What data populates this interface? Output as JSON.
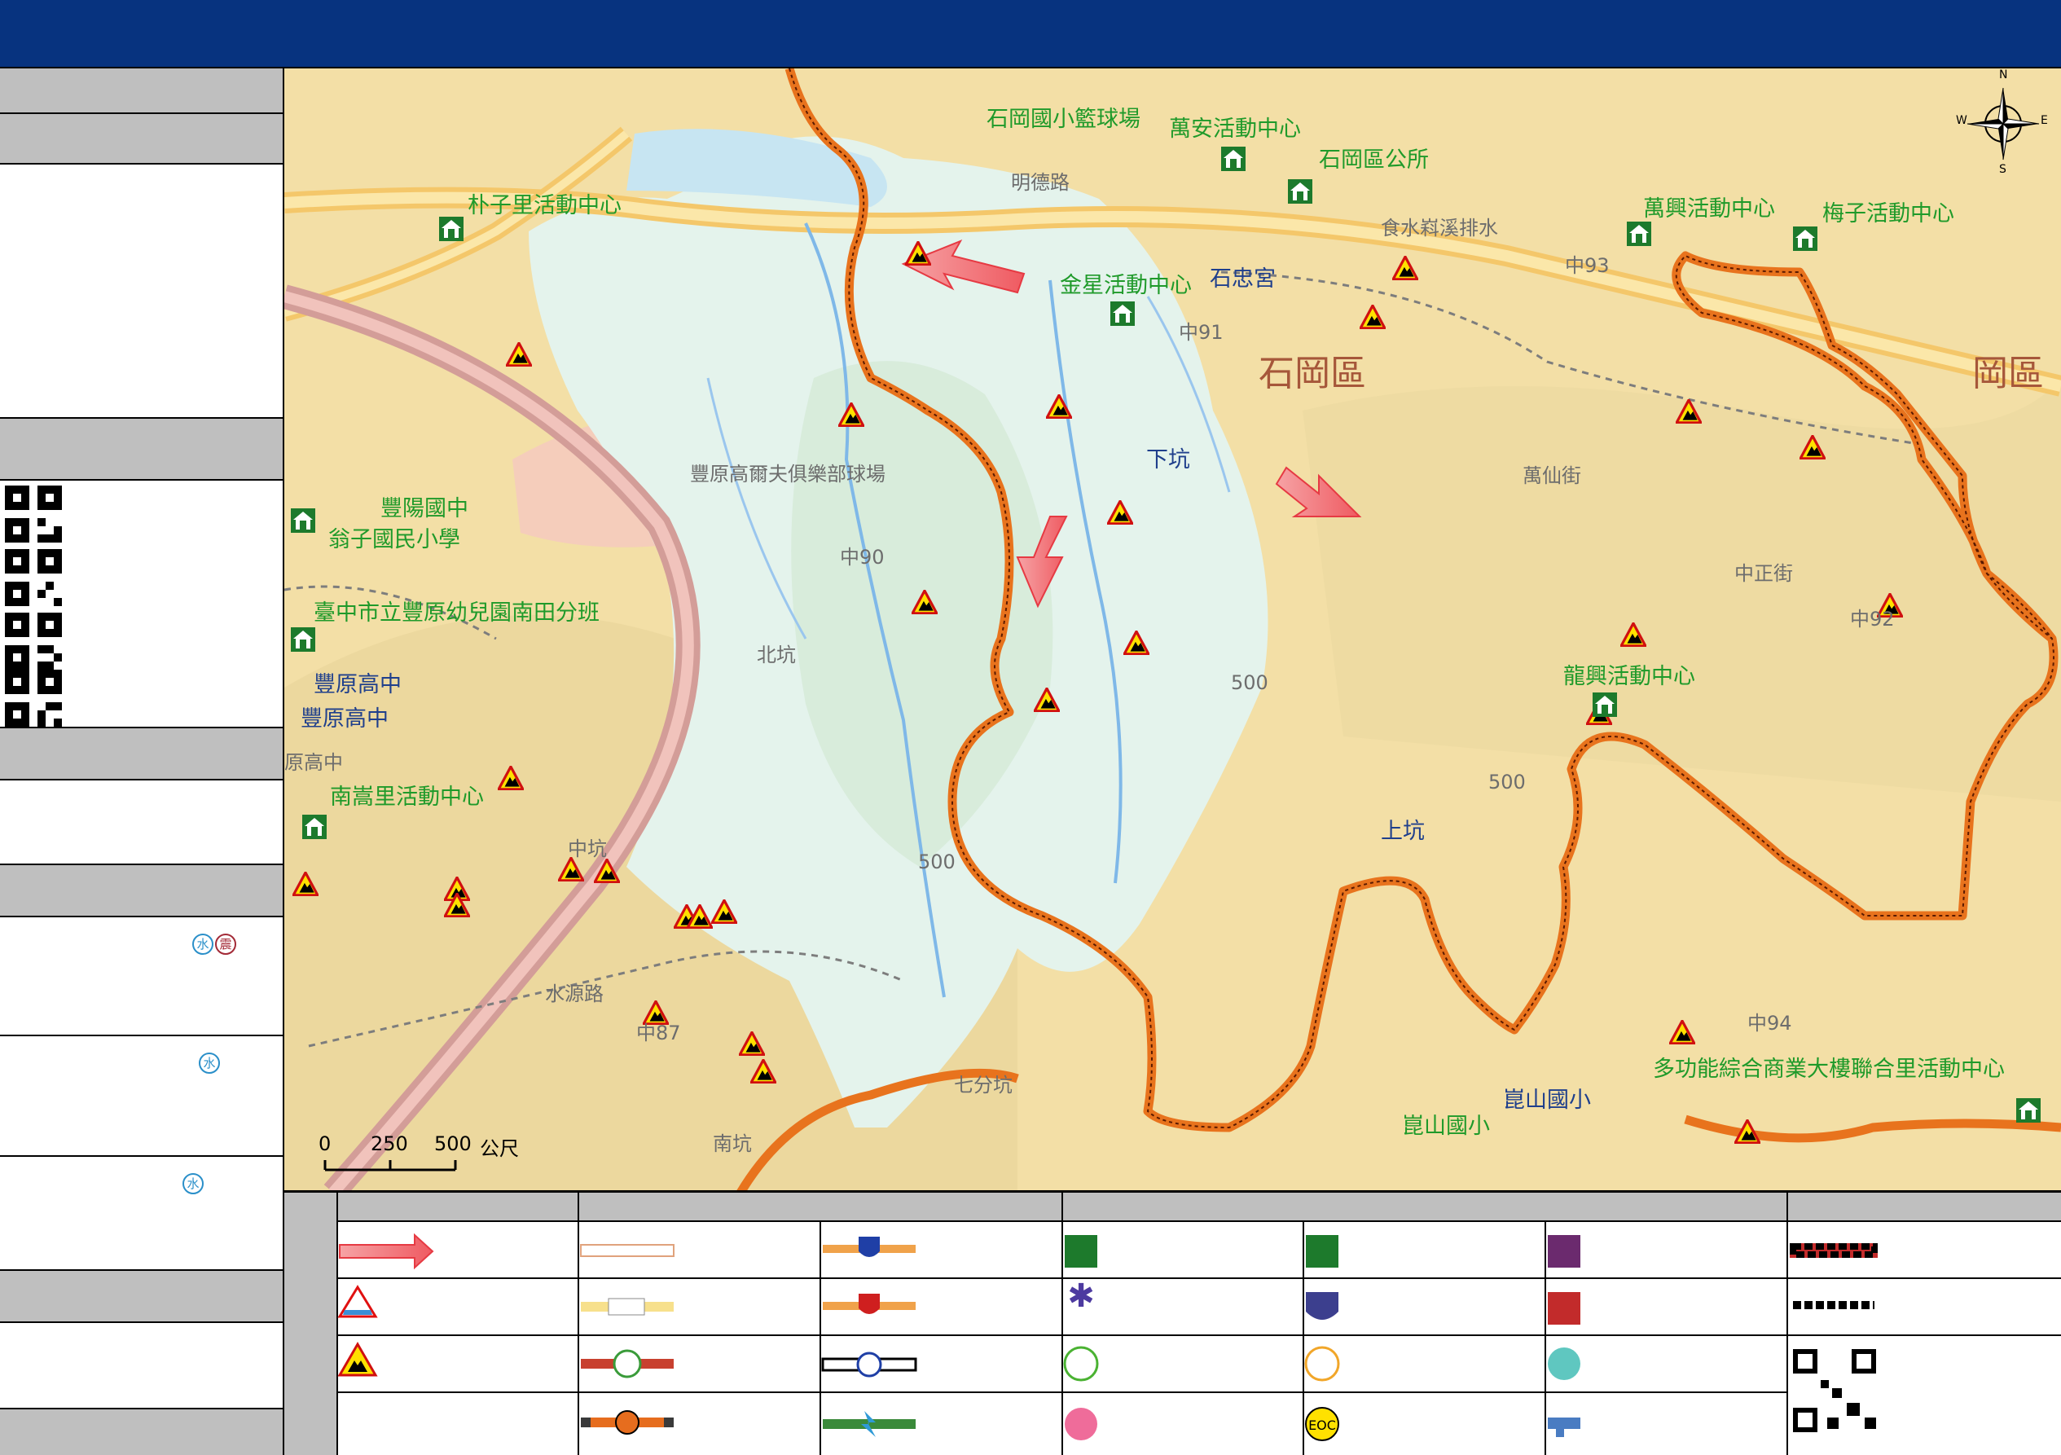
{
  "header": {
    "title": ""
  },
  "map": {
    "places": [
      {
        "id": "shigang-school",
        "text": "石岡國小籃球場",
        "cls": "g"
      },
      {
        "id": "wanan",
        "text": "萬安活動中心",
        "cls": "g"
      },
      {
        "id": "district-office",
        "text": "石岡區公所",
        "cls": "g"
      },
      {
        "id": "puzi",
        "text": "朴子里活動中心",
        "cls": "g"
      },
      {
        "id": "wanxing",
        "text": "萬興活動中心",
        "cls": "g"
      },
      {
        "id": "meizi",
        "text": "梅子活動中心",
        "cls": "g"
      },
      {
        "id": "jinxing",
        "text": "金星活動中心",
        "cls": "g"
      },
      {
        "id": "shizhong",
        "text": "石忠宮",
        "cls": "b"
      },
      {
        "id": "shigang-dist",
        "text": "石岡區",
        "cls": "d"
      },
      {
        "id": "gang-dist",
        "text": "岡區",
        "cls": "d"
      },
      {
        "id": "fengyang",
        "text": "豐陽國中",
        "cls": "g"
      },
      {
        "id": "wengzi",
        "text": "翁子國民小學",
        "cls": "g"
      },
      {
        "id": "golf",
        "text": "豐原高爾夫俱樂部球場",
        "cls": "s"
      },
      {
        "id": "kindergarten",
        "text": "臺中市立豐原幼兒園南田分班",
        "cls": "g"
      },
      {
        "id": "fengyuan-hs-1",
        "text": "豐原高中",
        "cls": "b"
      },
      {
        "id": "fengyuan-hs-2",
        "text": "豐原高中",
        "cls": "b"
      },
      {
        "id": "gaozhong",
        "text": "原高中",
        "cls": "s"
      },
      {
        "id": "nansong",
        "text": "南嵩里活動中心",
        "cls": "g"
      },
      {
        "id": "longxing",
        "text": "龍興活動中心",
        "cls": "g"
      },
      {
        "id": "kunshan-1",
        "text": "崑山國小",
        "cls": "b"
      },
      {
        "id": "kunshan-2",
        "text": "崑山國小",
        "cls": "g"
      },
      {
        "id": "multi",
        "text": "多功能綜合商業大樓聯合里活動中心",
        "cls": "g"
      },
      {
        "id": "mingde",
        "text": "明德路",
        "cls": "s"
      },
      {
        "id": "shuiyuan",
        "text": "水源路",
        "cls": "s"
      },
      {
        "id": "qifen",
        "text": "七分坑",
        "cls": "s"
      },
      {
        "id": "beikeng",
        "text": "北坑",
        "cls": "s"
      },
      {
        "id": "zhongkeng",
        "text": "中坑",
        "cls": "s"
      },
      {
        "id": "nankeng",
        "text": "南坑",
        "cls": "s"
      },
      {
        "id": "xiakeng",
        "text": "下坑",
        "cls": "b"
      },
      {
        "id": "shangkeng",
        "text": "上坑",
        "cls": "b"
      },
      {
        "id": "wanxianjie",
        "text": "萬仙街",
        "cls": "s"
      },
      {
        "id": "zhongzhengjie",
        "text": "中正街",
        "cls": "s"
      },
      {
        "id": "shishui",
        "text": "食水嵙溪排水",
        "cls": "s"
      },
      {
        "id": "route-93",
        "text": "中93",
        "cls": "s"
      },
      {
        "id": "route-90",
        "text": "中90",
        "cls": "s"
      },
      {
        "id": "route-92",
        "text": "中92",
        "cls": "s"
      },
      {
        "id": "route-94",
        "text": "中94",
        "cls": "s"
      },
      {
        "id": "route-91",
        "text": "中91",
        "cls": "s"
      },
      {
        "id": "route-87",
        "text": "中87",
        "cls": "s"
      },
      {
        "id": "c500a",
        "text": "500",
        "cls": "s"
      },
      {
        "id": "c500b",
        "text": "500",
        "cls": "s"
      },
      {
        "id": "c500c",
        "text": "500",
        "cls": "s"
      }
    ],
    "compass": {
      "n": "N",
      "s": "S",
      "e": "E",
      "w": "W"
    },
    "scalebar": {
      "t0": "0",
      "t1": "250",
      "t2": "500",
      "unit": "公尺"
    }
  },
  "sidebar": {
    "tags": [
      {
        "flood": "水",
        "quake": "震"
      },
      {
        "flood": "水"
      },
      {
        "flood": "水"
      }
    ]
  },
  "legend": {
    "eoc_label": "EOC"
  },
  "colors": {
    "title_bar": "#07337f",
    "panel_gray": "#bfbfbf",
    "boundary": "#e8731d",
    "shelter_green": "#1f9a2a"
  }
}
